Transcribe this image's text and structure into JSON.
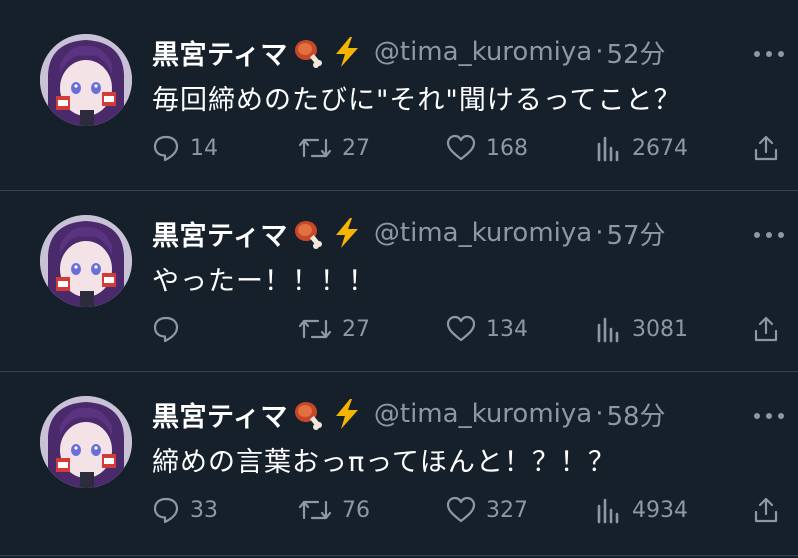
{
  "colors": {
    "background": "#15202b",
    "text_primary": "#ffffff",
    "text_secondary": "#8b98a5",
    "divider": "#38444d"
  },
  "tweets": [
    {
      "author_name": "黒宮ティマ",
      "name_emojis": [
        "meat-on-bone-icon",
        "lightning-icon"
      ],
      "handle": "@tima_kuromiya",
      "separator": "·",
      "time": "52分",
      "text": "毎回締めのたびに\"それ\"聞けるってこと？",
      "replies": "14",
      "retweets": "27",
      "likes": "168",
      "views": "2674"
    },
    {
      "author_name": "黒宮ティマ",
      "name_emojis": [
        "meat-on-bone-icon",
        "lightning-icon"
      ],
      "handle": "@tima_kuromiya",
      "separator": "·",
      "time": "57分",
      "text": "やったー！！！！",
      "replies": "",
      "retweets": "27",
      "likes": "134",
      "views": "3081"
    },
    {
      "author_name": "黒宮ティマ",
      "name_emojis": [
        "meat-on-bone-icon",
        "lightning-icon"
      ],
      "handle": "@tima_kuromiya",
      "separator": "·",
      "time": "58分",
      "text": "締めの言葉おっπってほんと！？！？",
      "replies": "33",
      "retweets": "76",
      "likes": "327",
      "views": "4934"
    }
  ]
}
